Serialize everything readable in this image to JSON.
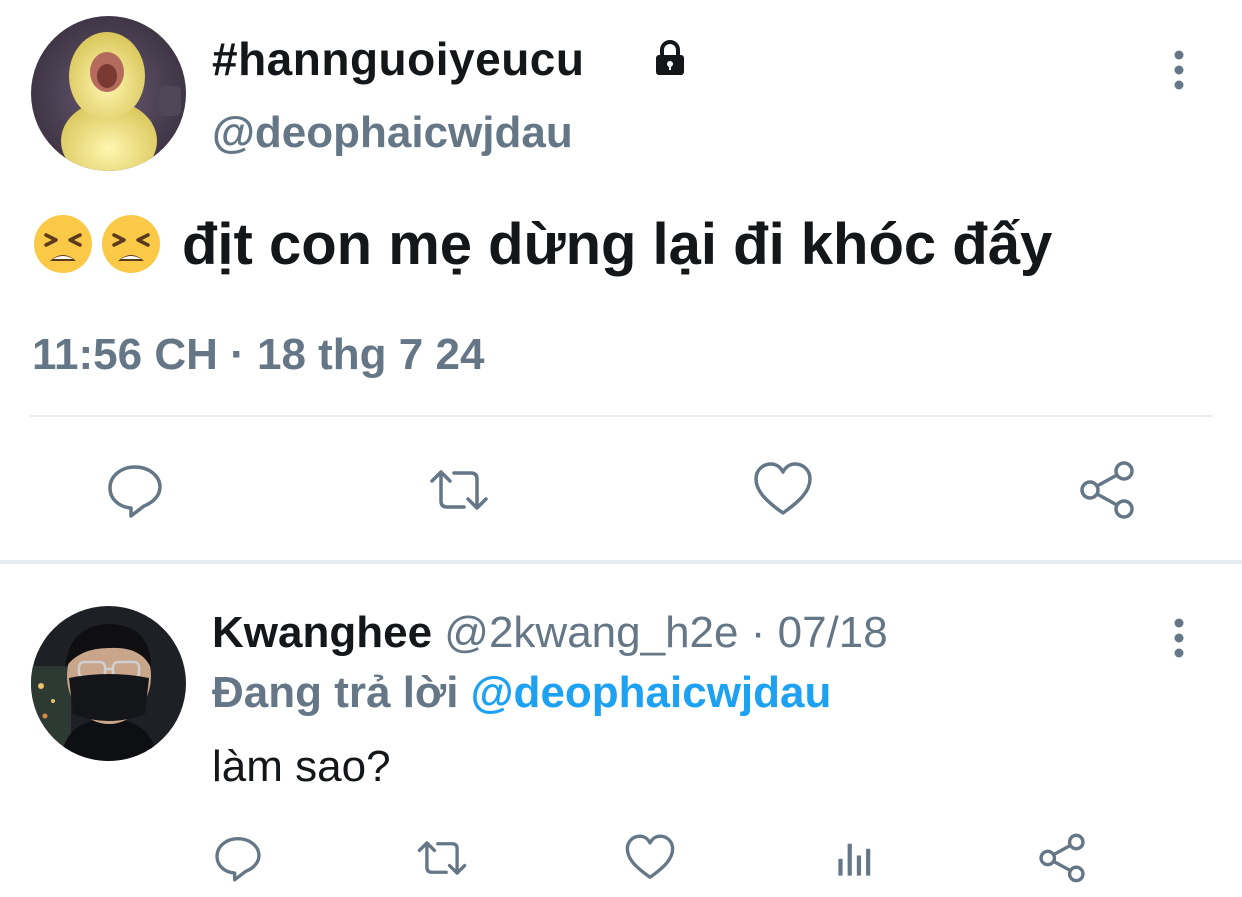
{
  "tweet": {
    "display_name": "#hannguoiyeucu",
    "handle": "@deophaicwjdau",
    "text": "địt con mẹ dừng lại đi khóc đấy",
    "timestamp": "11:56 CH · 18 thg 7 24",
    "icons": {
      "lock": "lock-icon",
      "more": "more-vertical-icon",
      "emoji": "tired-face-emoji",
      "reply": "comment-icon",
      "retweet": "retweet-icon",
      "like": "heart-icon",
      "share": "share-icon"
    }
  },
  "reply": {
    "display_name": "Kwanghee",
    "handle": "@2kwang_h2e",
    "separator": " · ",
    "date": "07/18",
    "replying_prefix": "Đang trả lời ",
    "replying_to": "@deophaicwjdau",
    "text": "làm sao?",
    "icons": {
      "more": "more-vertical-icon",
      "reply": "comment-icon",
      "retweet": "retweet-icon",
      "like": "heart-icon",
      "analytics": "analytics-icon",
      "share": "share-icon"
    }
  },
  "colors": {
    "text": "#14171a",
    "secondary": "#657786",
    "link": "#1da1f2",
    "divider": "#e6ecf0",
    "icon": "#657786"
  }
}
